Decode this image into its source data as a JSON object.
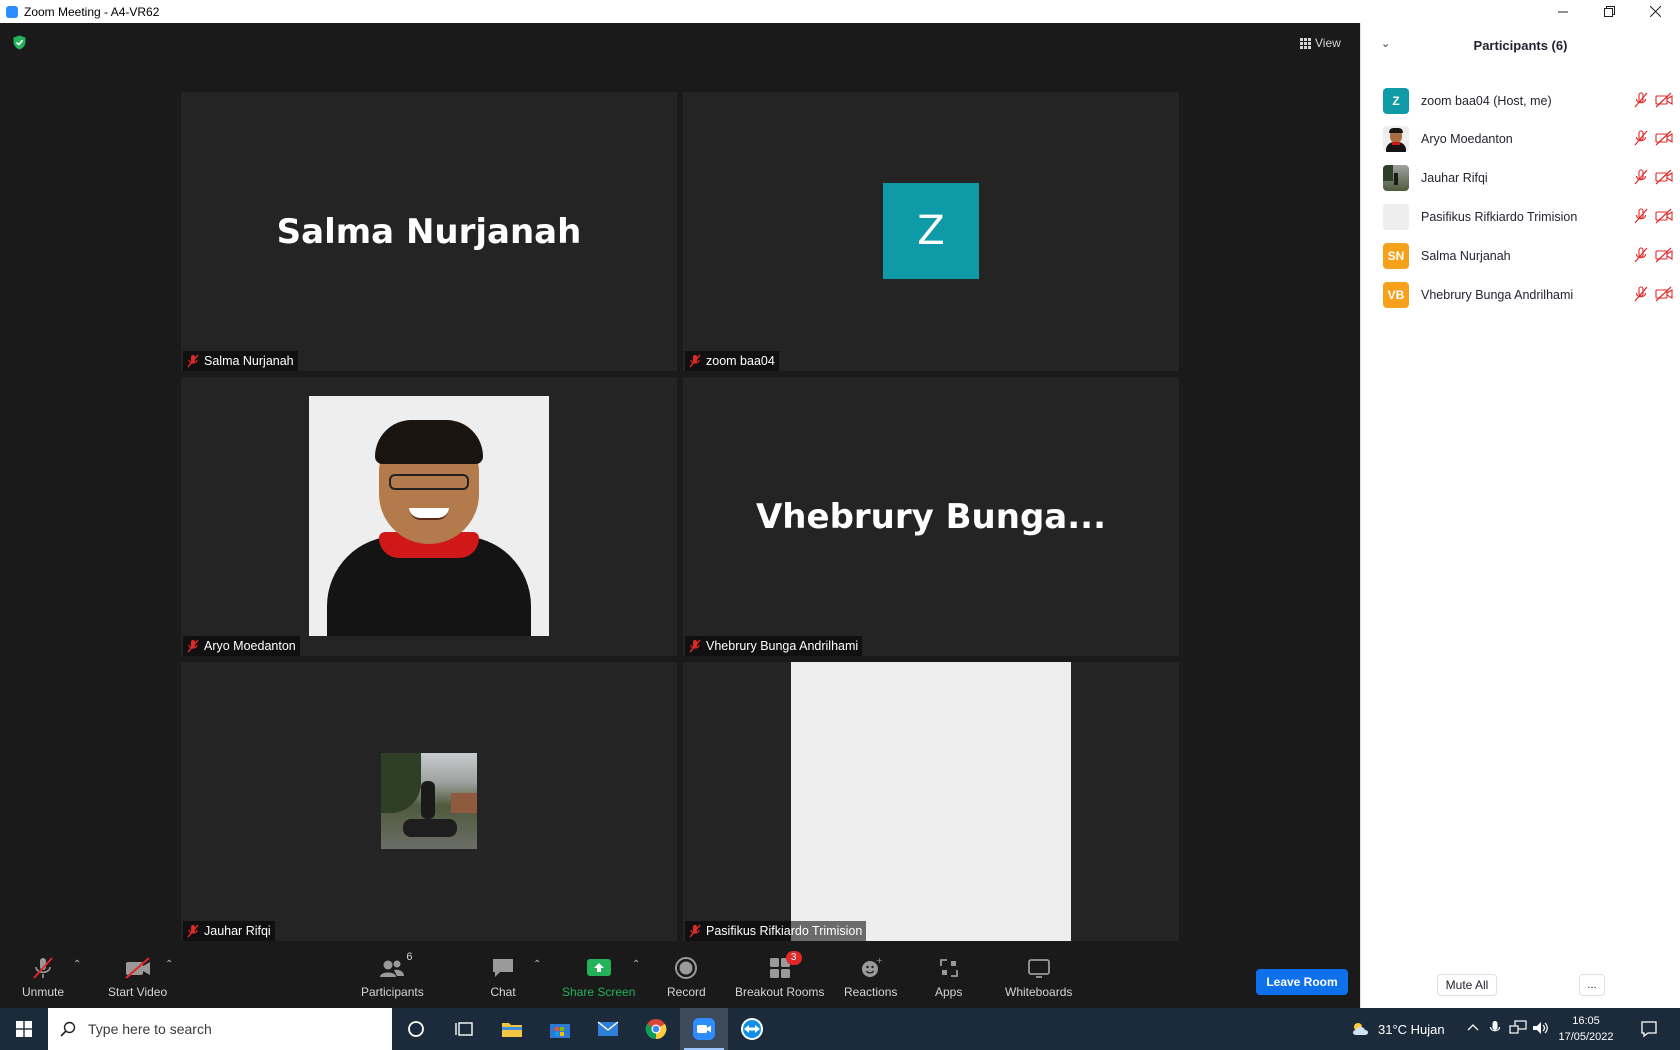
{
  "window": {
    "title": "Zoom Meeting - A4-VR62"
  },
  "meeting": {
    "view_label": "View",
    "tiles": [
      {
        "name": "Salma Nurjanah",
        "big_name": "Salma Nurjanah"
      },
      {
        "name": "zoom baa04",
        "avatar_letter": "Z"
      },
      {
        "name": "Aryo Moedanton"
      },
      {
        "name": "Vhebrury Bunga Andrilhami",
        "big_name": "Vhebrury  Bunga..."
      },
      {
        "name": "Jauhar Rifqi"
      },
      {
        "name": "Pasifikus Rifkiardo Trimision"
      }
    ]
  },
  "toolbar": {
    "unmute": "Unmute",
    "start_video": "Start Video",
    "participants": "Participants",
    "participants_count": "6",
    "chat": "Chat",
    "share_screen": "Share Screen",
    "record": "Record",
    "breakout_rooms": "Breakout Rooms",
    "breakout_badge": "3",
    "reactions": "Reactions",
    "apps": "Apps",
    "whiteboards": "Whiteboards",
    "leave": "Leave Room"
  },
  "panel": {
    "title": "Participants (6)",
    "participants": [
      {
        "name": "zoom baa04 (Host, me)",
        "initials": "Z",
        "color": "#0e9aa7"
      },
      {
        "name": "Aryo Moedanton",
        "initials": "",
        "color": "#eeeeee"
      },
      {
        "name": "Jauhar Rifqi",
        "initials": "",
        "color": "#4f5a3d"
      },
      {
        "name": "Pasifikus Rifkiardo Trimision",
        "initials": "",
        "color": "#eeeeee"
      },
      {
        "name": "Salma Nurjanah",
        "initials": "SN",
        "color": "#f7a01b"
      },
      {
        "name": "Vhebrury Bunga Andrilhami",
        "initials": "VB",
        "color": "#f7a01b"
      }
    ],
    "mute_all": "Mute All",
    "more": "..."
  },
  "taskbar": {
    "search_placeholder": "Type here to search",
    "weather": "31°C  Hujan",
    "time": "16:05",
    "date": "17/05/2022"
  },
  "colors": {
    "accent": "#0e71eb",
    "muted_red": "#e02828",
    "share_green": "#23b15a"
  }
}
